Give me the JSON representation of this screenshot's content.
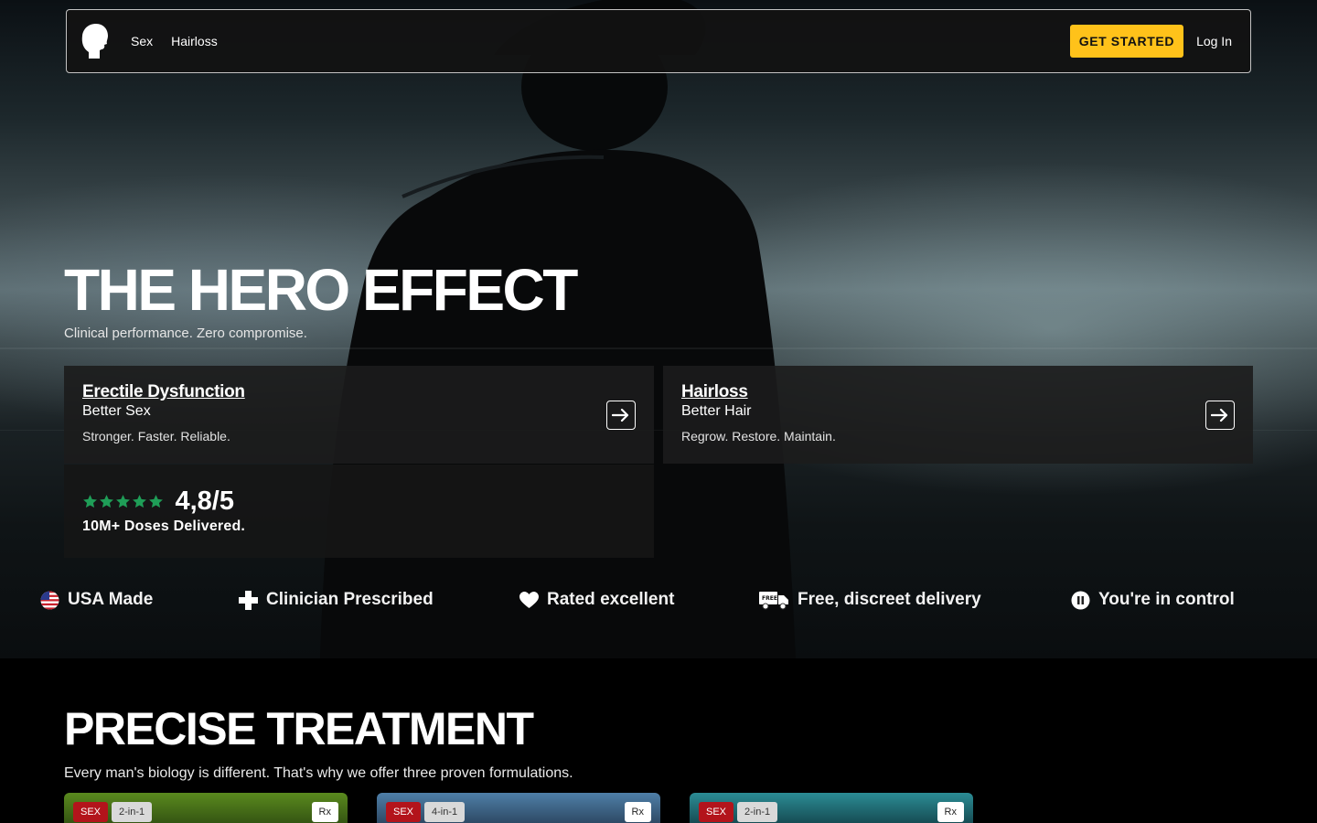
{
  "nav": {
    "links": [
      "Sex",
      "Hairloss"
    ],
    "cta_label": "GET STARTED",
    "login_label": "Log In"
  },
  "hero": {
    "title": "THE HERO EFFECT",
    "subtitle": "Clinical performance. Zero compromise."
  },
  "categories": [
    {
      "title": "Erectile Dysfunction",
      "subtitle": "Better Sex",
      "description": "Stronger. Faster. Reliable."
    },
    {
      "title": "Hairloss",
      "subtitle": "Better Hair",
      "description": "Regrow. Restore. Maintain."
    }
  ],
  "rating": {
    "stars": 5,
    "score": "4,8/5",
    "doses": "10M+ Doses Delivered.",
    "star_color": "#1f9d57"
  },
  "trust_items": [
    {
      "icon": "us-flag-icon",
      "label": "USA Made"
    },
    {
      "icon": "medical-cross-icon",
      "label": "Clinician Prescribed"
    },
    {
      "icon": "heart-icon",
      "label": "Rated excellent"
    },
    {
      "icon": "delivery-truck-icon",
      "label": "Free, discreet delivery"
    },
    {
      "icon": "pause-icon",
      "label": "You're in control"
    }
  ],
  "treatment": {
    "title": "PRECISE TREATMENT",
    "subtitle": "Every man's biology is different. That's why we offer three proven formulations."
  },
  "products": [
    {
      "category_tag": "SEX",
      "type_tag": "2-in-1",
      "rx_tag": "Rx"
    },
    {
      "category_tag": "SEX",
      "type_tag": "4-in-1",
      "rx_tag": "Rx"
    },
    {
      "category_tag": "SEX",
      "type_tag": "2-in-1",
      "rx_tag": "Rx"
    }
  ],
  "colors": {
    "accent": "#ffc21a",
    "tag_red": "#b3141b"
  }
}
